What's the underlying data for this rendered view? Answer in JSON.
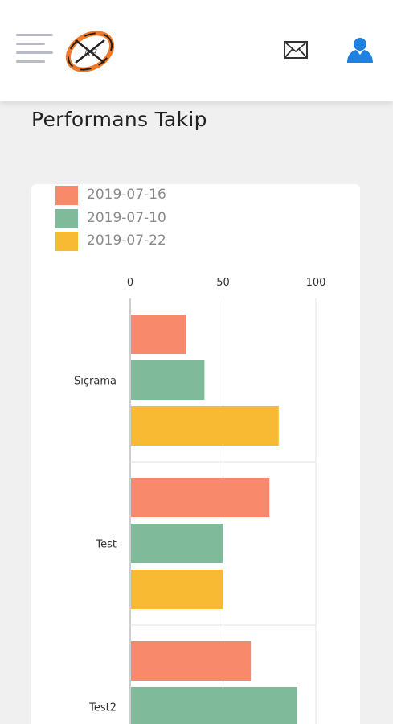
{
  "header": {
    "menu_icon": "hamburger-menu-icon",
    "logo_icon": "brand-logo-icon",
    "mail_icon": "envelope-icon",
    "user_icon": "user-icon"
  },
  "page": {
    "title": "Performans Takip"
  },
  "colors": {
    "series": [
      "#F9896B",
      "#7FBB9B",
      "#F8BA32"
    ],
    "grid": "#e3e3e3",
    "axis_text": "#333333",
    "user_icon": "#1e80e0"
  },
  "chart_data": {
    "type": "bar",
    "orientation": "horizontal",
    "categories": [
      "Sıçrama",
      "Test",
      "Test2"
    ],
    "series": [
      {
        "name": "2019-07-16",
        "values": [
          30,
          75,
          65
        ]
      },
      {
        "name": "2019-07-10",
        "values": [
          40,
          50,
          90
        ]
      },
      {
        "name": "2019-07-22",
        "values": [
          80,
          50,
          null
        ]
      }
    ],
    "xticks": [
      "0",
      "50",
      "100"
    ],
    "xlim": [
      0,
      100
    ],
    "legend_position": "top-left",
    "grid": true
  }
}
